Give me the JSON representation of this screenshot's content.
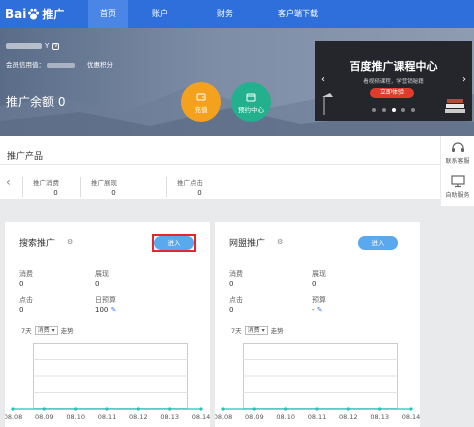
{
  "nav": {
    "logo_text": "Bai",
    "logo_suffix": "推广",
    "items": [
      {
        "label": "首页",
        "active": true
      },
      {
        "label": "账户",
        "active": false
      },
      {
        "label": "财务",
        "active": false
      },
      {
        "label": "客户端下载",
        "active": false
      }
    ]
  },
  "hero": {
    "user_suffix": "Y",
    "vip_badge": "V",
    "credit_label": "会员信用值：",
    "points_label": "优惠积分",
    "balance_label": "推广余额 0",
    "recharge_label": "充值",
    "booking_label": "预约中心"
  },
  "banner": {
    "title": "百度推广课程中心",
    "subtitle": "看视频课程，学营销秘籍",
    "button": "立即体验",
    "dots": 5,
    "active_dot": 2
  },
  "products": {
    "title": "推广产品",
    "cells": [
      {
        "label": "推广消费",
        "value": "0"
      },
      {
        "label": "推广展现",
        "value": "0"
      },
      {
        "label": "推广点击",
        "value": "0"
      }
    ]
  },
  "sidebar": {
    "contact": "联系客服",
    "self_service": "自助服务"
  },
  "cards": [
    {
      "title": "搜索推广",
      "enter": "进入",
      "consume_label": "消费",
      "consume_value": "0",
      "show_label": "展现",
      "show_value": "0",
      "click_label": "点击",
      "click_value": "0",
      "budget_label": "日预算",
      "budget_value": "100",
      "days_label": "7天",
      "metric_option": "消费",
      "trend_label": "走势"
    },
    {
      "title": "网盟推广",
      "enter": "进入",
      "consume_label": "消费",
      "consume_value": "0",
      "show_label": "展现",
      "show_value": "0",
      "click_label": "点击",
      "click_value": "0",
      "budget_label": "预算",
      "budget_value": "-",
      "days_label": "7天",
      "metric_option": "消费",
      "trend_label": "走势"
    }
  ],
  "chart_data": [
    {
      "type": "line",
      "categories": [
        "08.08",
        "08.09",
        "08.10",
        "08.11",
        "08.12",
        "08.13",
        "08.14"
      ],
      "series": [
        {
          "values": [
            0,
            0,
            0,
            0,
            0,
            0,
            0
          ]
        }
      ],
      "grid": true
    },
    {
      "type": "line",
      "categories": [
        "08.08",
        "08.09",
        "08.10",
        "08.11",
        "08.12",
        "08.13",
        "08.14"
      ],
      "series": [
        {
          "values": [
            0,
            0,
            0,
            0,
            0,
            0,
            0
          ]
        }
      ],
      "grid": true
    }
  ],
  "colors": {
    "nav_bg": "#2f6fdb",
    "accent_blue": "#5aa9ee",
    "recharge": "#f4a11e",
    "booking": "#23b08c",
    "highlight": "#e02a2a",
    "line": "#1fc7b8"
  }
}
